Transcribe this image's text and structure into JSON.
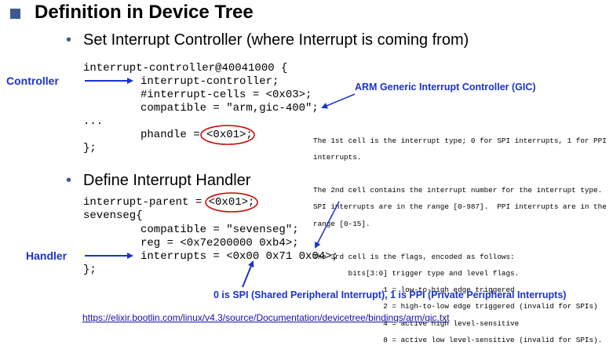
{
  "title": "Definition in Device Tree",
  "section1": {
    "heading": "Set Interrupt Controller (where Interrupt is coming from)",
    "code": [
      "interrupt-controller@40041000 {",
      "interrupt-controller;",
      "#interrupt-cells = <0x03>;",
      "compatible = \"arm,gic-400\";",
      "...",
      "phandle = <0x01>;",
      "};"
    ],
    "label_controller": "Controller",
    "annotation_gic": "ARM Generic Interrupt Controller (GIC)"
  },
  "section2": {
    "heading": "Define Interrupt Handler",
    "code": [
      "interrupt-parent = <0x01>;",
      "sevenseg{",
      "compatible = \"sevenseg\";",
      "reg = <0x7e200000 0xb4>;",
      "interrupts = <0x00 0x71 0x04>;",
      "};"
    ],
    "label_handler": "Handler",
    "annotation_spi": "0 is SPI (Shared Peripheral Interrupt), 1 is PPI (Private Peripheral Interrupts)"
  },
  "notes": [
    "The 1st cell is the interrupt type; 0 for SPI interrupts, 1 for PPI",
    "interrupts.",
    "",
    "The 2nd cell contains the interrupt number for the interrupt type.",
    "SPI interrupts are in the range [0-987].  PPI interrupts are in the",
    "range [0-15].",
    "",
    "The 3rd cell is the flags, encoded as follows:",
    "        bits[3:0] trigger type and level flags.",
    "                1 = low-to-high edge triggered",
    "                2 = high-to-low edge triggered (invalid for SPIs)",
    "                4 = active high level-sensitive",
    "                8 = active low level-sensitive (invalid for SPIs)."
  ],
  "link": "https://elixir.bootlin.com/linux/v4.3/source/Documentation/devicetree/bindings/arm/gic.txt",
  "colors": {
    "bullet": "#3f5a8c",
    "label": "#1a33cc",
    "circle": "#cc0000",
    "arrow": "#1a33cc"
  }
}
